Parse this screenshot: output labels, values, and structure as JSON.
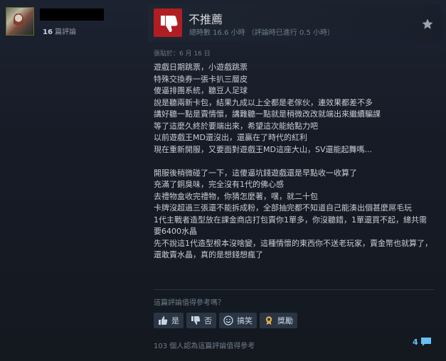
{
  "author": {
    "review_count": "16",
    "review_count_label": "篇評論"
  },
  "review": {
    "verdict": "不推薦",
    "hours": "總時數 16.6 小時 （評論時已進行 0.5 小時）",
    "posted": "張貼於：6 月 16 日",
    "body": "遊戲日期跳票，小遊戲跳票\n特殊交換券一張卡扒三層皮\n傻逼排團系統，聽豆人足球\n說是聽兩新卡包，結果九成以上全都是老傢伙，連效果都差不多\n講好聽一點是賣情懷，講難聽一點就是稍微改改就端出來繼續騙課\n等了這麼久終於要端出來，希望這次能給點力吧\n以前遊戲王MD還沒出，還贏在了時代的紅利\n現在重新開服，又要面對遊戲王MD這座大山，SV還能起舞嗎...\n\n開服後稍微碰了一下，這傻逼坑錢遊戲還是早點收一收算了\n充滿了銅臭味，完全沒有1代的佛心感\n去禮物盒收完禮物，你猜怎麼著，嘿，就二十包\n卡牌沒超過三張還不能拆成粉，全部抽完都不知道自己能湊出個甚麼屌毛玩\n1代主戰者造型放在課金商店打包賣你1單多，你沒聽錯，1單還買不起，總共需要6400水晶\n先不說這1代造型根本沒啥變，這種情懷的東西你不送老玩家，賣金幣也就算了，還敢賣水晶，真的是想錢想瘋了"
  },
  "feedback": {
    "question": "這篇評論值得參考嗎？",
    "yes_label": "是",
    "no_label": "否",
    "funny_label": "搞笑",
    "award_label": "獎勵",
    "found_helpful": "103 個人認為這篇評論值得參考",
    "comment_count": "4"
  },
  "colors": {
    "thumb_down_bg": "#b01e23",
    "link_blue": "#66c0f4",
    "award_gold": "#e0b04c"
  },
  "icons": [
    "thumbs-down-icon",
    "star-icon",
    "thumbs-up-icon",
    "smile-icon",
    "award-icon",
    "comment-icon"
  ]
}
